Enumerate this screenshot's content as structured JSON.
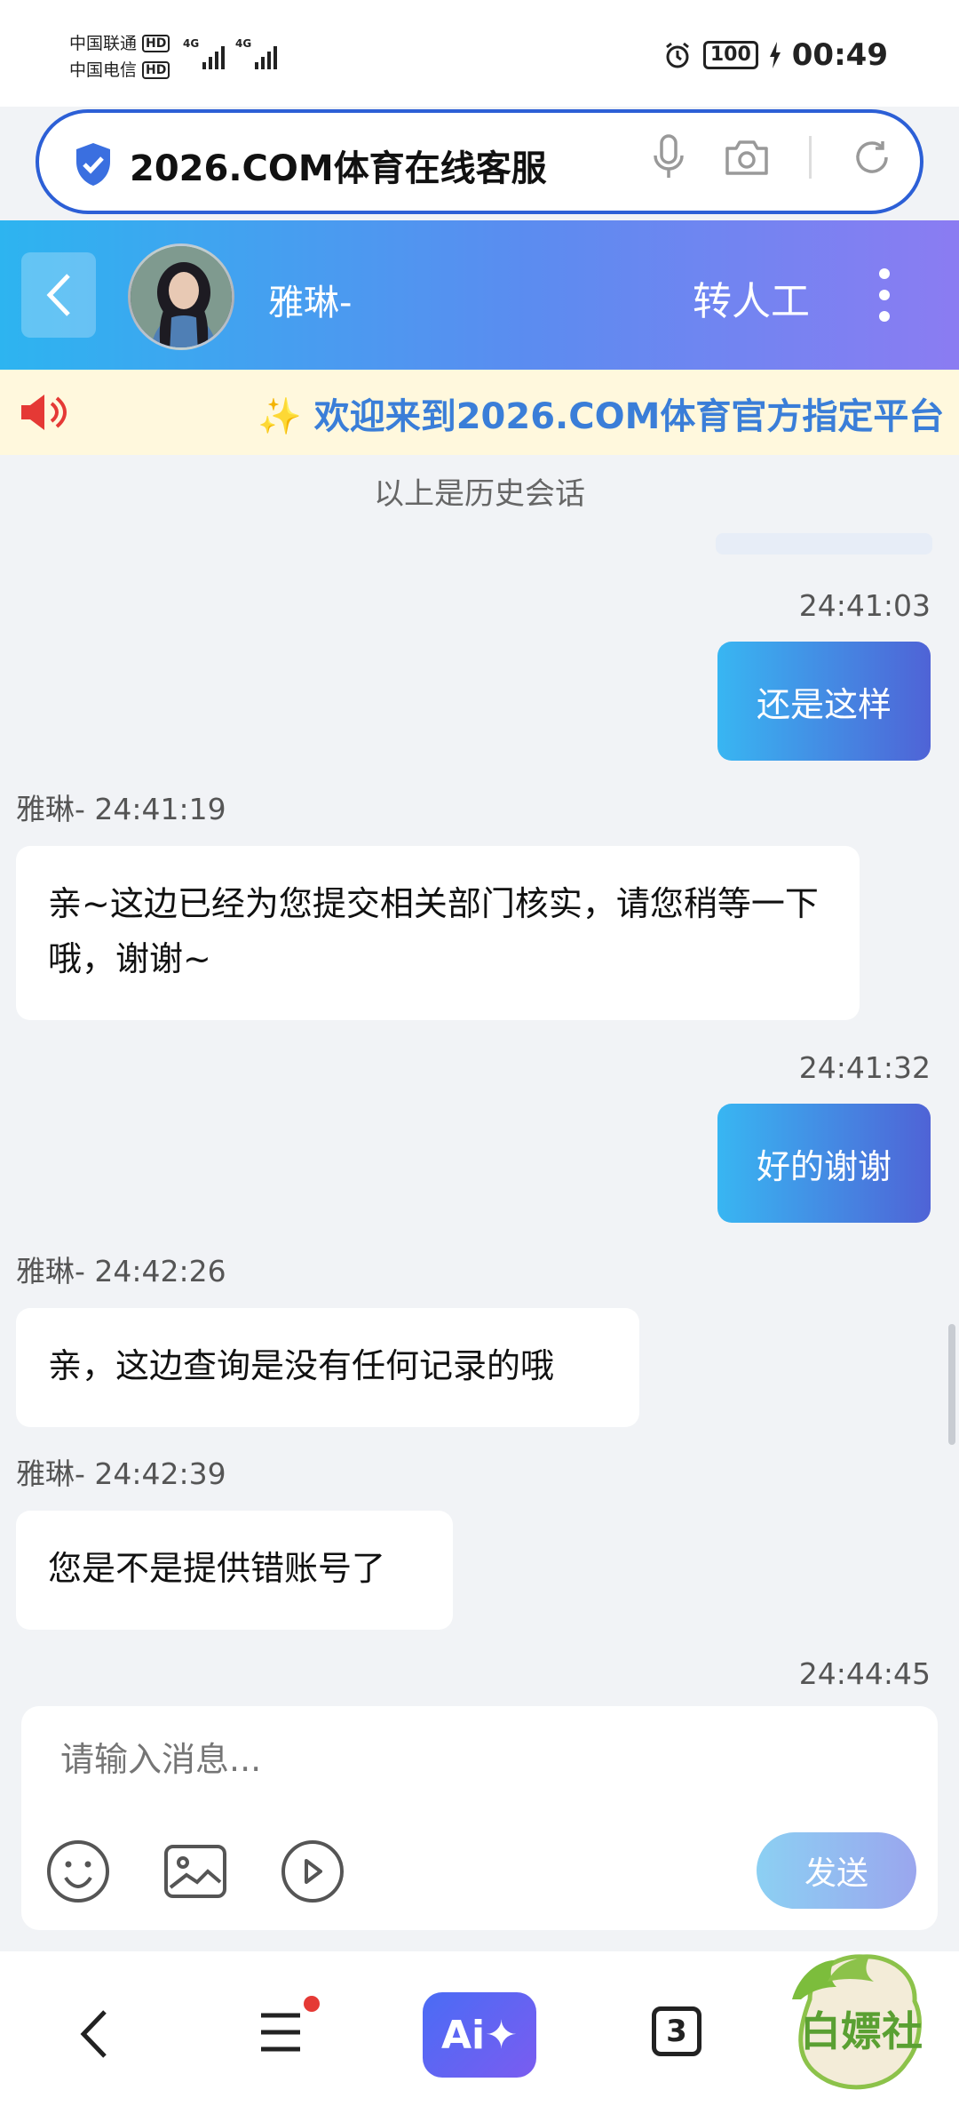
{
  "status_bar": {
    "carrier1": "中国联通",
    "carrier2": "中国电信",
    "hd": "HD",
    "network": "4G",
    "battery": "100",
    "time": "00:49"
  },
  "address_bar": {
    "url_text": "2026.COM体育在线客服"
  },
  "chat_header": {
    "agent_name": "雅琳-",
    "transfer_label": "转人工"
  },
  "notice": {
    "text": "✨ 欢迎来到2026.COM体育官方指定平台 ✨"
  },
  "messages": {
    "history_label": "以上是历史会话",
    "items": [
      {
        "side": "right",
        "time": "24:41:03",
        "text": "还是这样"
      },
      {
        "side": "left",
        "header": "雅琳- 24:41:19",
        "text": "亲~这边已经为您提交相关部门核实，请您稍等一下哦，谢谢~"
      },
      {
        "side": "right",
        "time": "24:41:32",
        "text": "好的谢谢"
      },
      {
        "side": "left",
        "header": "雅琳- 24:42:26",
        "text": "亲，这边查询是没有任何记录的哦"
      },
      {
        "side": "left",
        "header": "雅琳- 24:42:39",
        "text": "您是不是提供错账号了"
      },
      {
        "side": "right",
        "time": "24:44:45",
        "text": ""
      }
    ]
  },
  "input": {
    "placeholder": "请输入消息...",
    "send_label": "发送"
  },
  "bottom_nav": {
    "ai_label": "Ai✦",
    "tab_count": "3"
  },
  "watermark": {
    "text": "白嫖社"
  },
  "colors": {
    "accent_blue": "#2c5fd6",
    "header_gradient_start": "#2db4f0",
    "header_gradient_end": "#8b7cf2",
    "notice_text": "#3a7ed8",
    "user_bubble_start": "#38b6f2",
    "user_bubble_end": "#4f63d6"
  }
}
